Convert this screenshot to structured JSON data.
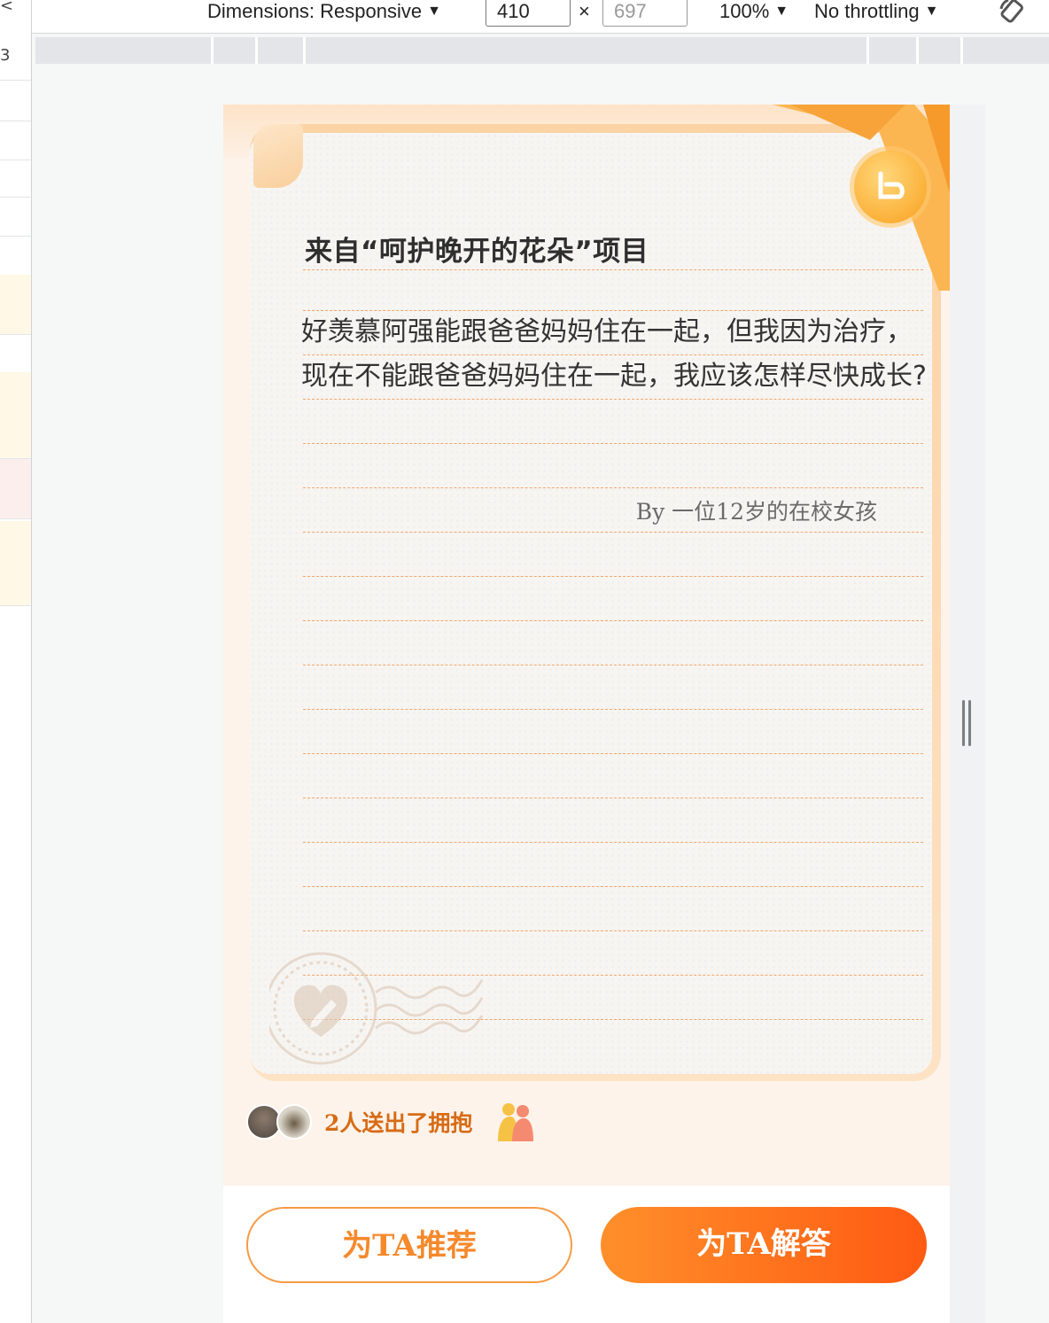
{
  "devtools": {
    "dimensions_label": "Dimensions: Responsive",
    "width_value": "410",
    "times_symbol": "×",
    "height_placeholder": "697",
    "zoom_label": "100%",
    "throttle_label": "No throttling",
    "caret": "▼",
    "left_glyphs": [
      "<",
      "3"
    ]
  },
  "letter": {
    "title": "来自“呵护晚开的花朵”项目",
    "body": "好羡慕阿强能跟爸爸妈妈住在一起，但我因为治疗，现在不能跟爸爸妈妈住在一起，我应该怎样尽快成长?",
    "signature": "By 一位12岁的在校女孩"
  },
  "hugs": {
    "text": "2人送出了拥抱"
  },
  "actions": {
    "recommend_label": "为TA推荐",
    "answer_label": "为TA解答"
  },
  "colors": {
    "accent_orange": "#ff6a1a",
    "accent_light": "#f79a45",
    "hug_text": "#d76b16",
    "ruled_line": "#f4a66a"
  },
  "icons": [
    "rotate-device-icon",
    "resize-handle-icon",
    "coin-logo-icon",
    "heart-pen-stamp-icon",
    "hug-icon"
  ]
}
